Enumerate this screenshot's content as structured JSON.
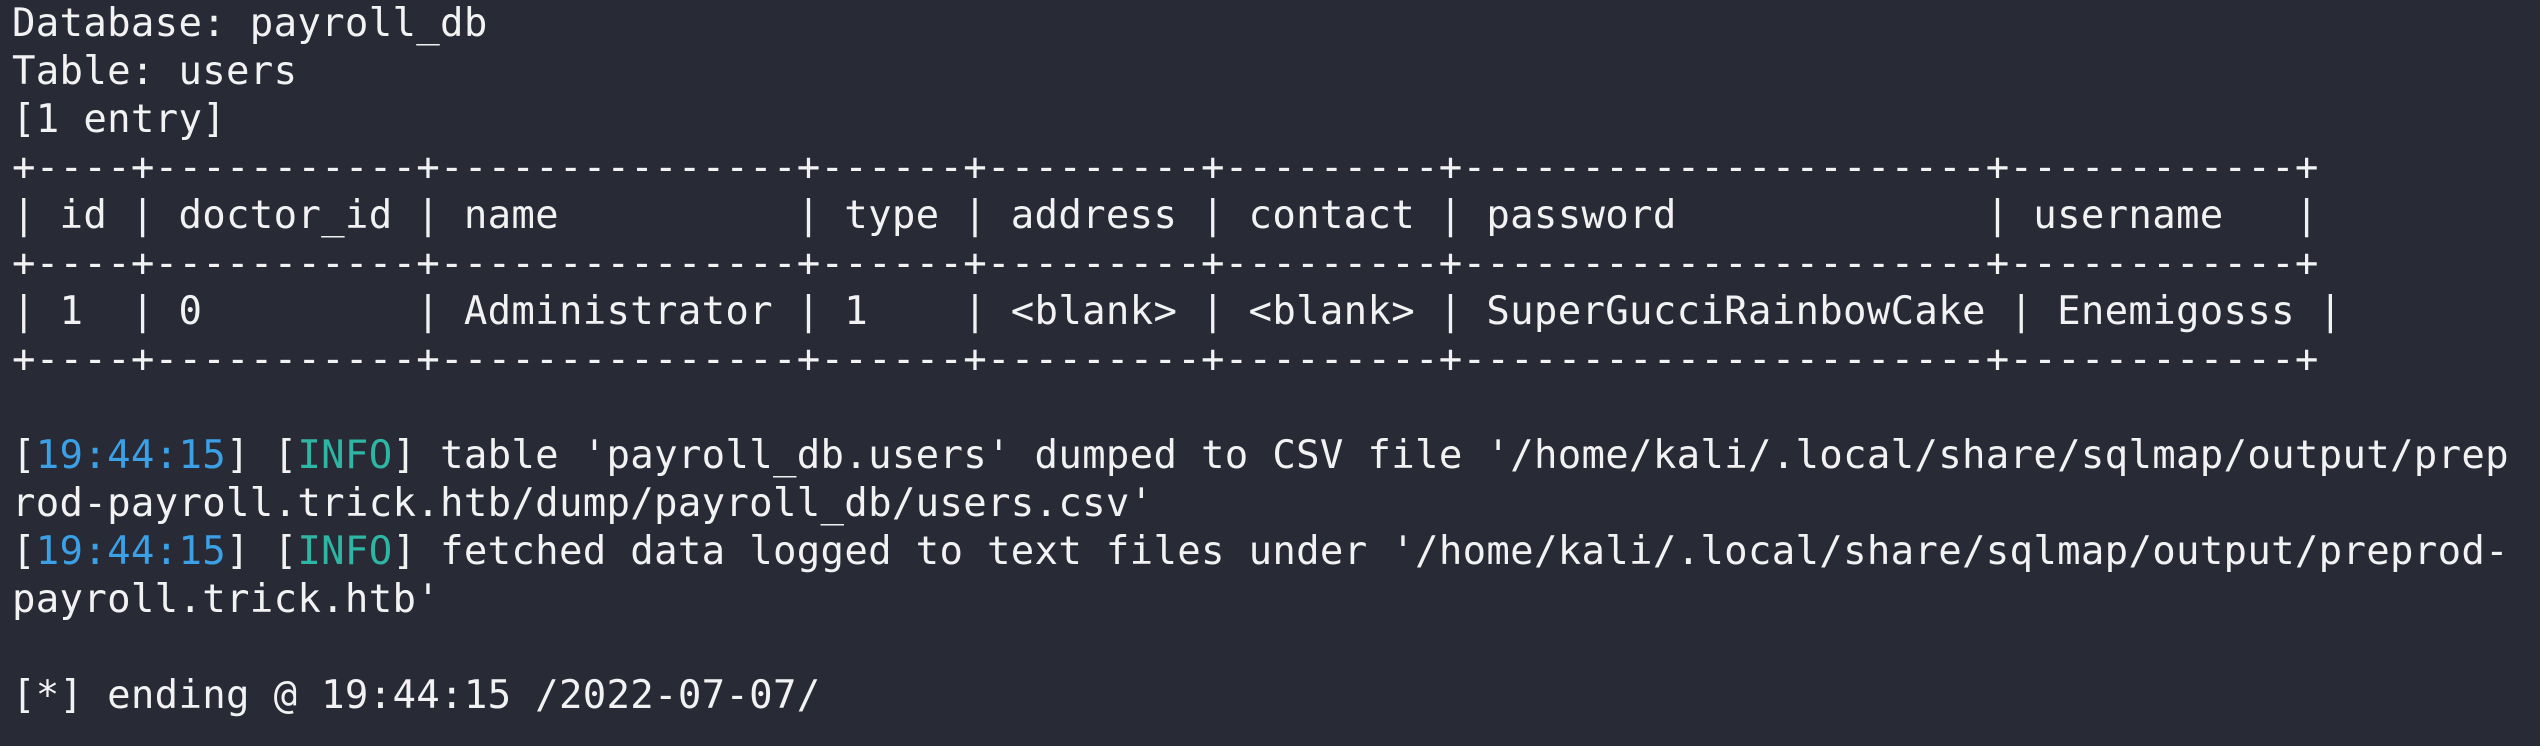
{
  "terminal": {
    "header": {
      "database": "Database: payroll_db",
      "table": "Table: users",
      "entries": "[1 entry]"
    },
    "dump_table": {
      "border": "+----+-----------+---------------+------+---------+---------+----------------------+------------+",
      "header_row": "| id | doctor_id | name          | type | address | contact | password             | username   |",
      "data_row": "| 1  | 0         | Administrator | 1    | <blank> | <blank> | SuperGucciRainbowCake | Enemigosss |",
      "columns": [
        "id",
        "doctor_id",
        "name",
        "type",
        "address",
        "contact",
        "password",
        "username"
      ],
      "rows": [
        [
          "1",
          "0",
          "Administrator",
          "1",
          "<blank>",
          "<blank>",
          "SuperGucciRainbowCake",
          "Enemigosss"
        ]
      ]
    },
    "log": [
      {
        "time": "19:44:15",
        "level": "INFO",
        "message_line1": " table 'payroll_db.users' dumped to CSV file '/home/kali/.local/share/sqlmap/output/prep",
        "message_line2": "rod-payroll.trick.htb/dump/payroll_db/users.csv'"
      },
      {
        "time": "19:44:15",
        "level": "INFO",
        "message_line1": " fetched data logged to text files under '/home/kali/.local/share/sqlmap/output/preprod-",
        "message_line2": "payroll.trick.htb'"
      }
    ],
    "footer": "[*] ending @ 19:44:15 /2022-07-07/"
  },
  "colors": {
    "background": "#282a36",
    "text": "#f2f2f2",
    "timestamp": "#3ba0e6",
    "info": "#2fb5a3"
  }
}
